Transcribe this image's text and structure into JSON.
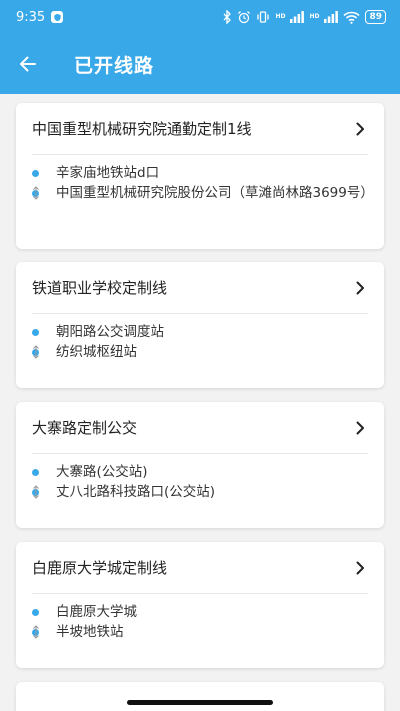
{
  "status_bar": {
    "time": "9:35",
    "battery": "89",
    "network_label": "HD"
  },
  "header": {
    "title": "已开线路"
  },
  "routes": [
    {
      "name": "中国重型机械研究院通勤定制1线",
      "from": "辛家庙地铁站d口",
      "to": "中国重型机械研究院股份公司（草滩尚林路3699号）"
    },
    {
      "name": "铁道职业学校定制线",
      "from": "朝阳路公交调度站",
      "to": "纺织城枢纽站"
    },
    {
      "name": "大寨路定制公交",
      "from": "大寨路(公交站)",
      "to": "丈八北路科技路口(公交站)"
    },
    {
      "name": "白鹿原大学城定制线",
      "from": "白鹿原大学城",
      "to": "半坡地铁站"
    }
  ],
  "colors": {
    "accent": "#39a8e8",
    "background": "#f2f2f2",
    "card": "#ffffff"
  }
}
